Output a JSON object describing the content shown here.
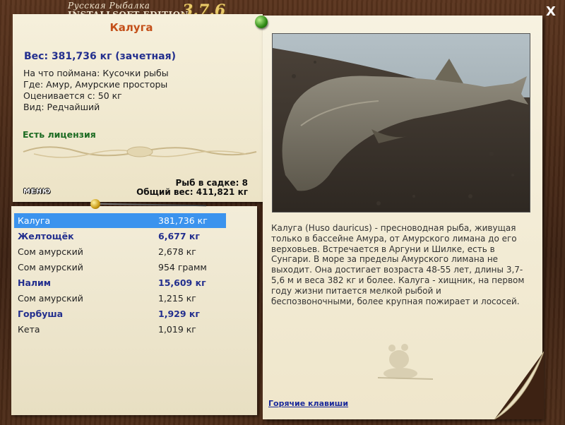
{
  "window": {
    "title_ru": "Русская Рыбалка",
    "title_en": "INSTALLSOFT EDITION",
    "version": "3.7.6",
    "close_label": "X"
  },
  "fish_card": {
    "name": "Калуга",
    "weight": "Вес: 381,736 кг (зачетная)",
    "bait": "На что поймана: Кусочки рыбы",
    "location": "Где: Амур, Амурские просторы",
    "price": "Оценивается с: 50 кг",
    "rarity": "Вид: Редчайший",
    "license": "Есть лицензия"
  },
  "keep": {
    "menu_label": "МЕНЮ",
    "fish_count": "Рыб в садке: 8",
    "total_weight": "Общий вес: 411,821 кг"
  },
  "catch_list": [
    {
      "name": "Калуга",
      "weight": "381,736 кг",
      "style": "sel"
    },
    {
      "name": "Желтощёк",
      "weight": "6,677 кг",
      "style": "bold"
    },
    {
      "name": "Сом амурский",
      "weight": "2,678 кг",
      "style": "norm"
    },
    {
      "name": "Сом амурский",
      "weight": "954 грамм",
      "style": "norm"
    },
    {
      "name": "Налим",
      "weight": "15,609 кг",
      "style": "bold"
    },
    {
      "name": "Сом амурский",
      "weight": "1,215 кг",
      "style": "norm"
    },
    {
      "name": "Горбуша",
      "weight": "1,929 кг",
      "style": "bold"
    },
    {
      "name": "Кета",
      "weight": "1,019 кг",
      "style": "norm"
    }
  ],
  "description": {
    "text": "Калуга (Huso dauricus) - пресноводная рыба, живущая только в бассейне Амура, от Амурского лимана до его верховьев. Встречается в Аргуни и Шилке, есть в Сунгари. В море за пределы Амурского лимана не выходит. Она достигает возраста 48-55 лет, длины 3,7-5,6 м и веса 382 кг и более. Калуга - хищник, на первом году жизни питается мелкой рыбой и беспозвоночными, более крупная пожирает и лососей."
  },
  "footer": {
    "hotkeys_label": "Горячие клавиши"
  },
  "colors": {
    "selected_row": "#3b93ee",
    "fish_name": "#c4501a",
    "weight_text": "#232f8e",
    "license_text": "#1c6b22"
  }
}
